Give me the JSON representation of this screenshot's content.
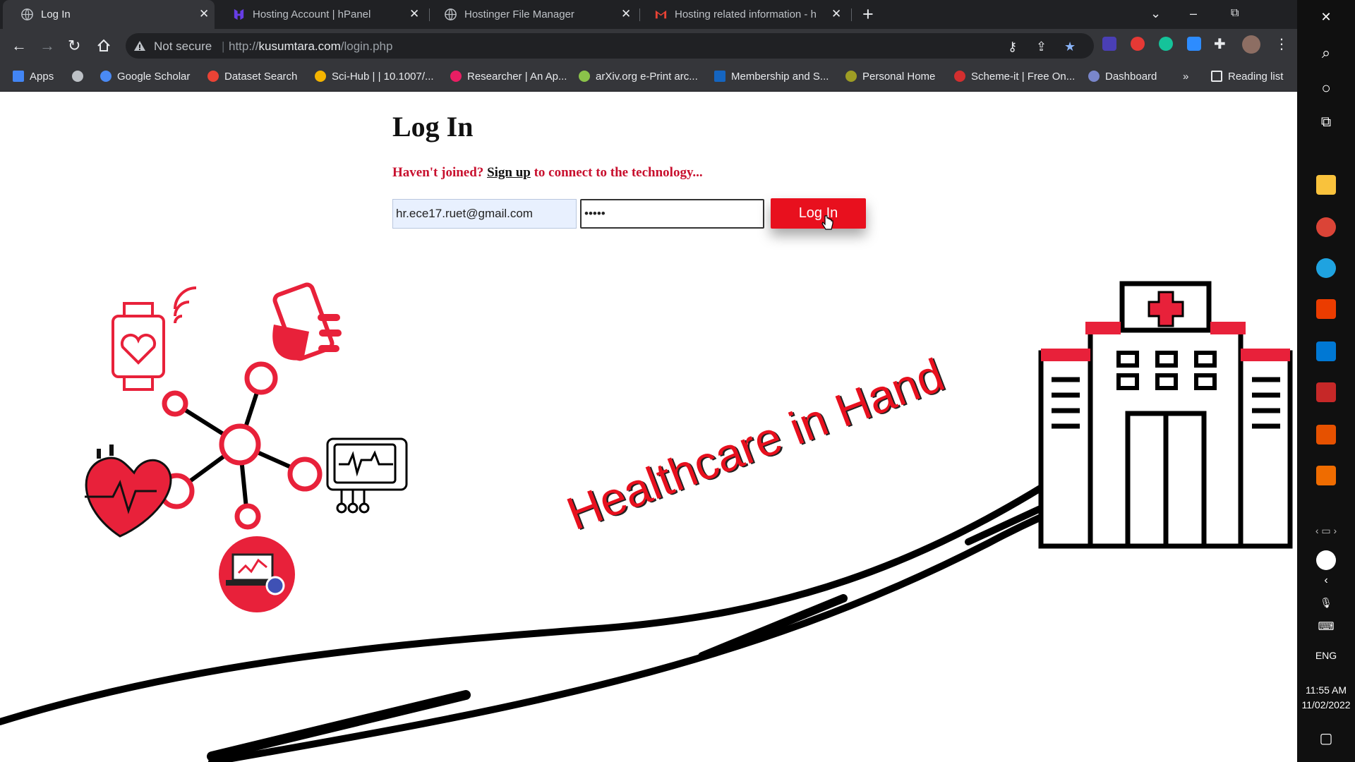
{
  "browser": {
    "tabs": [
      {
        "label": "Log In",
        "active": true
      },
      {
        "label": "Hosting Account | hPanel",
        "active": false
      },
      {
        "label": "Hostinger File Manager",
        "active": false
      },
      {
        "label": "Hosting related information - hr.",
        "active": false
      }
    ],
    "close_glyph": "✕",
    "new_tab_glyph": "+",
    "address": {
      "security_label": "Not secure",
      "separator": "|",
      "url_prefix": "http://",
      "url_host": "kusumtara.com",
      "url_path": "/login.php"
    },
    "bookmarks": [
      {
        "label": "Apps",
        "color": "#4285f4"
      },
      {
        "label": "Google Scholar",
        "color": "#4a8af4"
      },
      {
        "label": "Dataset Search",
        "color": "#ea4335"
      },
      {
        "label": "Sci-Hub | | 10.1007/...",
        "color": "#f4b400"
      },
      {
        "label": "Researcher | An Ap...",
        "color": "#e91e63"
      },
      {
        "label": "arXiv.org e-Print arc...",
        "color": "#8bc34a"
      },
      {
        "label": "Membership and S...",
        "color": "#1565c0"
      },
      {
        "label": "Personal Home",
        "color": "#9e9d24"
      },
      {
        "label": "Scheme-it | Free On...",
        "color": "#d32f2f"
      },
      {
        "label": "Dashboard",
        "color": "#7986cb"
      }
    ],
    "bookmarks_more": "»",
    "reading_list": "Reading list"
  },
  "page": {
    "title": "Log In",
    "join_prefix": "Haven't joined?",
    "signup_link": "Sign up",
    "join_suffix": "to connect to the technology...",
    "email_value": "hr.ece17.ruet@gmail.com",
    "password_value": "•••••",
    "login_button": "Log In",
    "tagline": "Healthcare in Hand"
  },
  "taskbar": {
    "language": "ENG",
    "time": "11:55 AM",
    "date": "11/02/2022"
  },
  "colors": {
    "accent_red": "#e8101e",
    "tab_bar": "#202124",
    "toolbar": "#35363a"
  }
}
